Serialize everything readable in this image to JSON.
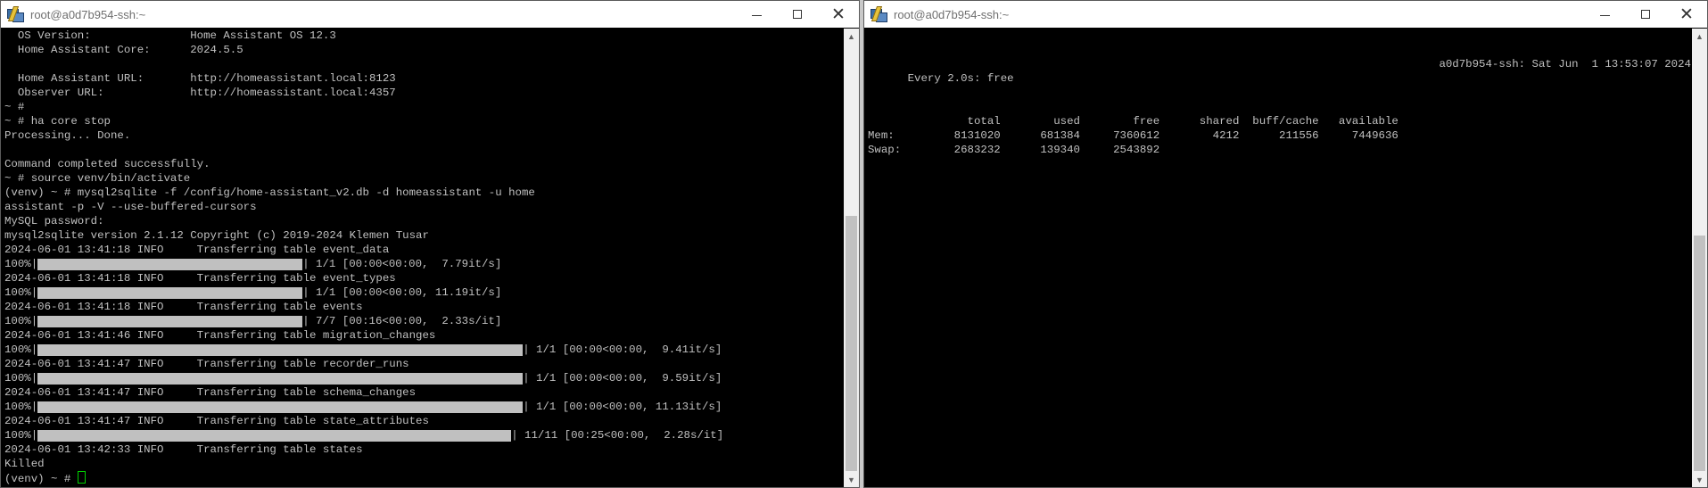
{
  "left_window": {
    "title": "root@a0d7b954-ssh:~",
    "lines": [
      "  OS Version:               Home Assistant OS 12.3",
      "  Home Assistant Core:      2024.5.5",
      "",
      "  Home Assistant URL:       http://homeassistant.local:8123",
      "  Observer URL:             http://homeassistant.local:4357",
      "~ #",
      "~ # ha core stop",
      "Processing... Done.",
      "",
      "Command completed successfully.",
      "~ # source venv/bin/activate",
      "(venv) ~ # mysql2sqlite -f /config/home-assistant_v2.db -d homeassistant -u home",
      "assistant -p -V --use-buffered-cursors",
      "MySQL password:",
      "mysql2sqlite version 2.1.12 Copyright (c) 2019-2024 Klemen Tusar"
    ],
    "transfers": [
      {
        "log": "2024-06-01 13:41:18 INFO     Transferring table event_data",
        "pct": "100%|",
        "stats": "| 1/1 [00:00<00:00,  7.79it/s]",
        "bar": "short"
      },
      {
        "log": "2024-06-01 13:41:18 INFO     Transferring table event_types",
        "pct": "100%|",
        "stats": "| 1/1 [00:00<00:00, 11.19it/s]",
        "bar": "short"
      },
      {
        "log": "2024-06-01 13:41:18 INFO     Transferring table events",
        "pct": "100%|",
        "stats": "| 7/7 [00:16<00:00,  2.33s/it]",
        "bar": "short"
      },
      {
        "log": "2024-06-01 13:41:46 INFO     Transferring table migration_changes",
        "pct": "100%|",
        "stats": "| 1/1 [00:00<00:00,  9.41it/s]",
        "bar": "long"
      },
      {
        "log": "2024-06-01 13:41:47 INFO     Transferring table recorder_runs",
        "pct": "100%|",
        "stats": "| 1/1 [00:00<00:00,  9.59it/s]",
        "bar": "long"
      },
      {
        "log": "2024-06-01 13:41:47 INFO     Transferring table schema_changes",
        "pct": "100%|",
        "stats": "| 1/1 [00:00<00:00, 11.13it/s]",
        "bar": "long"
      },
      {
        "log": "2024-06-01 13:41:47 INFO     Transferring table state_attributes",
        "pct": "100%|",
        "stats": "| 11/11 [00:25<00:00,  2.28s/it]",
        "bar": "medium"
      }
    ],
    "tail_lines": [
      "2024-06-01 13:42:33 INFO     Transferring table states",
      "Killed"
    ],
    "prompt": "(venv) ~ # "
  },
  "right_window": {
    "title": "root@a0d7b954-ssh:~",
    "watch_left": "Every 2.0s: free",
    "watch_right": "a0d7b954-ssh: Sat Jun  1 13:53:07 2024",
    "free_lines": [
      "",
      "               total        used        free      shared  buff/cache   available",
      "Mem:         8131020      681384     7360612        4212      211556     7449636",
      "Swap:        2683232      139340     2543892"
    ]
  },
  "icons": {
    "app": "putty-icon",
    "minimize": "minimize-icon",
    "maximize": "maximize-icon",
    "close": "close-icon"
  },
  "colors": {
    "terminal_bg": "#000000",
    "terminal_fg": "#c0c0c0",
    "cursor": "#00d000",
    "titlebar_bg": "#ffffff"
  }
}
